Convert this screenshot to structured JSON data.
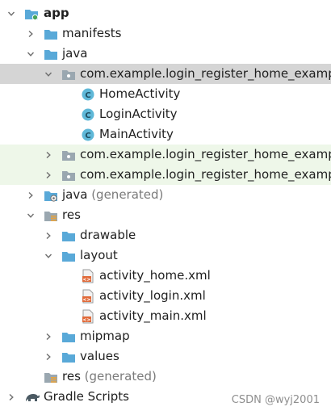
{
  "project_tree": {
    "rows": [
      {
        "label": "app",
        "suffix": "",
        "bold": true,
        "chevron": "down",
        "icon": "module-folder-icon",
        "depth": 0,
        "state": "normal",
        "name": "tree-item-app"
      },
      {
        "label": "manifests",
        "suffix": "",
        "bold": false,
        "chevron": "right",
        "icon": "folder-icon",
        "depth": 1,
        "state": "normal",
        "name": "tree-item-manifests"
      },
      {
        "label": "java",
        "suffix": "",
        "bold": false,
        "chevron": "down",
        "icon": "folder-icon",
        "depth": 1,
        "state": "normal",
        "name": "tree-item-java"
      },
      {
        "label": "com.example.login_register_home_example",
        "suffix": "",
        "bold": false,
        "chevron": "down",
        "icon": "package-icon",
        "depth": 2,
        "state": "selected",
        "name": "tree-item-package-main"
      },
      {
        "label": "HomeActivity",
        "suffix": "",
        "bold": false,
        "chevron": "",
        "icon": "class-icon",
        "depth": 3,
        "state": "normal",
        "name": "tree-item-home-activity"
      },
      {
        "label": "LoginActivity",
        "suffix": "",
        "bold": false,
        "chevron": "",
        "icon": "class-icon",
        "depth": 3,
        "state": "normal",
        "name": "tree-item-login-activity"
      },
      {
        "label": "MainActivity",
        "suffix": "",
        "bold": false,
        "chevron": "",
        "icon": "class-icon",
        "depth": 3,
        "state": "normal",
        "name": "tree-item-main-activity"
      },
      {
        "label": "com.example.login_register_home_example",
        "suffix": "",
        "bold": false,
        "chevron": "right",
        "icon": "package-icon",
        "depth": 2,
        "state": "highlight",
        "name": "tree-item-package-android-test"
      },
      {
        "label": "com.example.login_register_home_example",
        "suffix": "",
        "bold": false,
        "chevron": "right",
        "icon": "package-icon",
        "depth": 2,
        "state": "highlight",
        "name": "tree-item-package-test"
      },
      {
        "label": "java",
        "suffix": " (generated)",
        "bold": false,
        "chevron": "right",
        "icon": "generated-folder-icon",
        "depth": 1,
        "state": "normal",
        "name": "tree-item-java-generated"
      },
      {
        "label": "res",
        "suffix": "",
        "bold": false,
        "chevron": "down",
        "icon": "res-folder-icon",
        "depth": 1,
        "state": "normal",
        "name": "tree-item-res"
      },
      {
        "label": "drawable",
        "suffix": "",
        "bold": false,
        "chevron": "right",
        "icon": "folder-icon",
        "depth": 2,
        "state": "normal",
        "name": "tree-item-drawable"
      },
      {
        "label": "layout",
        "suffix": "",
        "bold": false,
        "chevron": "down",
        "icon": "folder-icon",
        "depth": 2,
        "state": "normal",
        "name": "tree-item-layout"
      },
      {
        "label": "activity_home.xml",
        "suffix": "",
        "bold": false,
        "chevron": "",
        "icon": "xml-file-icon",
        "depth": 3,
        "state": "normal",
        "name": "tree-item-activity-home-xml"
      },
      {
        "label": "activity_login.xml",
        "suffix": "",
        "bold": false,
        "chevron": "",
        "icon": "xml-file-icon",
        "depth": 3,
        "state": "normal",
        "name": "tree-item-activity-login-xml"
      },
      {
        "label": "activity_main.xml",
        "suffix": "",
        "bold": false,
        "chevron": "",
        "icon": "xml-file-icon",
        "depth": 3,
        "state": "normal",
        "name": "tree-item-activity-main-xml"
      },
      {
        "label": "mipmap",
        "suffix": "",
        "bold": false,
        "chevron": "right",
        "icon": "folder-icon",
        "depth": 2,
        "state": "normal",
        "name": "tree-item-mipmap"
      },
      {
        "label": "values",
        "suffix": "",
        "bold": false,
        "chevron": "right",
        "icon": "folder-icon",
        "depth": 2,
        "state": "normal",
        "name": "tree-item-values"
      },
      {
        "label": "res",
        "suffix": " (generated)",
        "bold": false,
        "chevron": "",
        "icon": "res-folder-icon",
        "depth": 1,
        "state": "normal",
        "name": "tree-item-res-generated"
      },
      {
        "label": "Gradle Scripts",
        "suffix": "",
        "bold": false,
        "chevron": "right",
        "icon": "gradle-icon",
        "depth": 0,
        "state": "normal",
        "name": "tree-item-gradle-scripts"
      }
    ]
  },
  "watermark": "CSDN @wyj2001",
  "colors": {
    "selected_row": "#d5d5d5",
    "highlight_row": "#eef7e9",
    "folder_blue": "#59a9d8",
    "class_badge": "#5fb8d8",
    "xml_orange": "#e06a3a"
  }
}
